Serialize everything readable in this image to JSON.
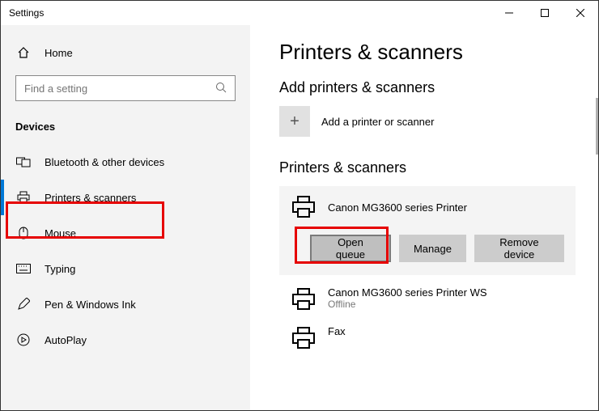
{
  "window": {
    "title": "Settings"
  },
  "sidebar": {
    "home": "Home",
    "search_placeholder": "Find a setting",
    "section": "Devices",
    "items": [
      {
        "label": "Bluetooth & other devices"
      },
      {
        "label": "Printers & scanners"
      },
      {
        "label": "Mouse"
      },
      {
        "label": "Typing"
      },
      {
        "label": "Pen & Windows Ink"
      },
      {
        "label": "AutoPlay"
      }
    ]
  },
  "page": {
    "title": "Printers & scanners",
    "add_section_title": "Add printers & scanners",
    "add_label": "Add a printer or scanner",
    "list_title": "Printers & scanners",
    "selected_device": {
      "name": "Canon MG3600 series Printer",
      "buttons": {
        "open_queue": "Open queue",
        "manage": "Manage",
        "remove": "Remove device"
      }
    },
    "devices": [
      {
        "name": "Canon MG3600 series Printer WS",
        "status": "Offline"
      },
      {
        "name": "Fax",
        "status": ""
      }
    ]
  }
}
